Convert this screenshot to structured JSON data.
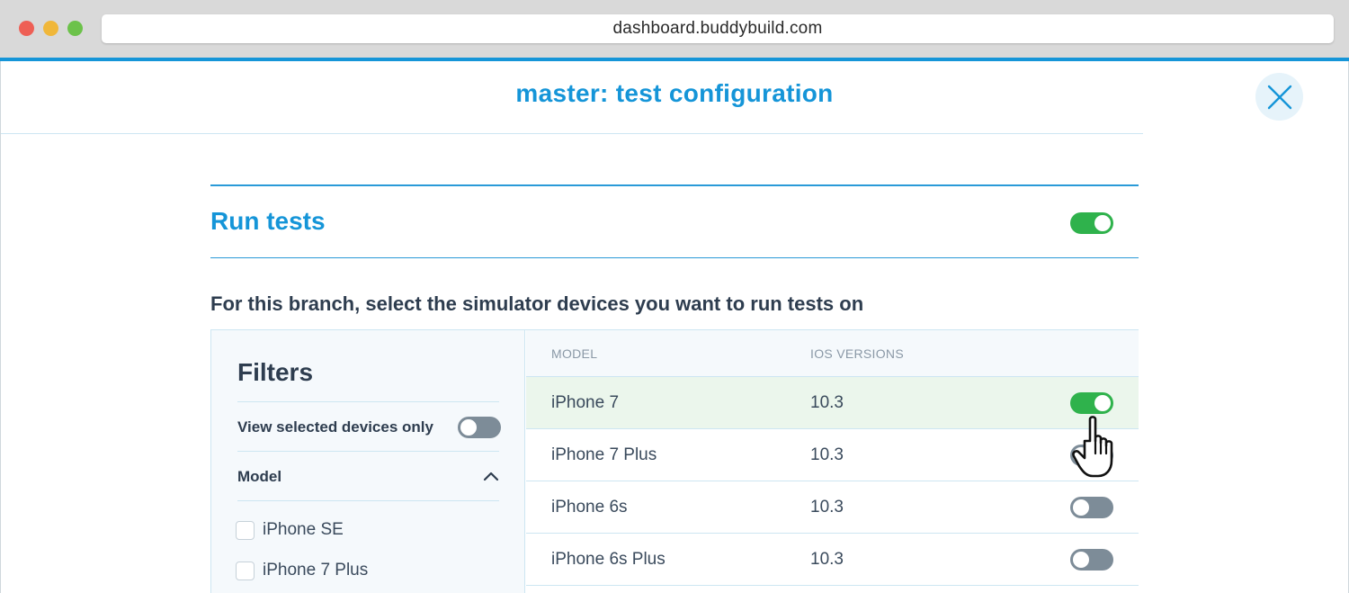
{
  "browser": {
    "url": "dashboard.buddybuild.com"
  },
  "modal": {
    "title": "master: test configuration"
  },
  "run_tests": {
    "title": "Run tests",
    "enabled": true
  },
  "section_heading": "For this branch, select the simulator devices you want to run tests on",
  "filters": {
    "title": "Filters",
    "view_selected_label": "View selected devices only",
    "view_selected_enabled": false,
    "model_label": "Model",
    "model_options": [
      {
        "label": "iPhone SE",
        "checked": false
      },
      {
        "label": "iPhone 7 Plus",
        "checked": false
      }
    ]
  },
  "table": {
    "headers": {
      "model": "MODEL",
      "ios_versions": "IOS VERSIONS"
    },
    "rows": [
      {
        "model": "iPhone 7",
        "ios": "10.3",
        "enabled": true
      },
      {
        "model": "iPhone 7 Plus",
        "ios": "10.3",
        "enabled": false
      },
      {
        "model": "iPhone 6s",
        "ios": "10.3",
        "enabled": false
      },
      {
        "model": "iPhone 6s Plus",
        "ios": "10.3",
        "enabled": false
      }
    ]
  },
  "colors": {
    "accent": "#1595d8",
    "toggle_on": "#2fb24c",
    "toggle_off": "#7d8c98",
    "selected_row": "#ebf6ec"
  },
  "icons": {
    "close": "close-x-icon",
    "collapse": "chevron-up-icon",
    "cursor": "pointer-hand-icon"
  }
}
